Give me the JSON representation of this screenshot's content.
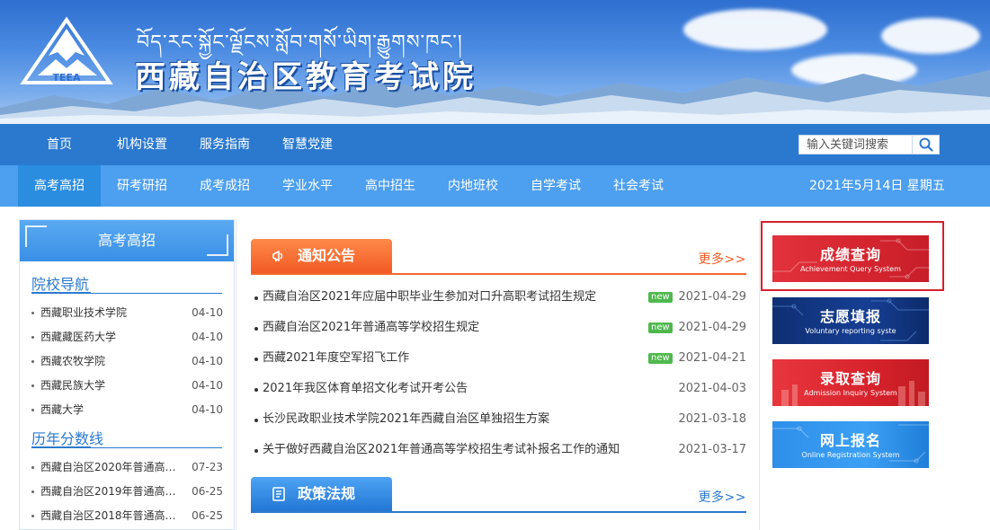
{
  "banner": {
    "tibetan_title": "བོད་རང་སྐྱོང་ལྗོངས་སློབ་གསོ་ཡིག་རྒྱུགས་ཁང་།",
    "site_title": "西藏自治区教育考试院",
    "logo_text": "TEEA"
  },
  "nav_main": [
    {
      "label": "首页"
    },
    {
      "label": "机构设置"
    },
    {
      "label": "服务指南"
    },
    {
      "label": "智慧党建"
    }
  ],
  "search": {
    "placeholder": "输入关键词搜索",
    "icon": "search-icon"
  },
  "nav_sub": [
    {
      "label": "高考高招"
    },
    {
      "label": "研考研招"
    },
    {
      "label": "成考成招"
    },
    {
      "label": "学业水平"
    },
    {
      "label": "高中招生"
    },
    {
      "label": "内地班校"
    },
    {
      "label": "自学考试"
    },
    {
      "label": "社会考试"
    }
  ],
  "date": "2021年5月14日 星期五",
  "sidebar": {
    "header": "高考高招",
    "sections": [
      {
        "title": "院校导航",
        "items": [
          {
            "label": "西藏职业技术学院",
            "date": "04-10"
          },
          {
            "label": "西藏藏医药大学",
            "date": "04-10"
          },
          {
            "label": "西藏农牧学院",
            "date": "04-10"
          },
          {
            "label": "西藏民族大学",
            "date": "04-10"
          },
          {
            "label": "西藏大学",
            "date": "04-10"
          }
        ]
      },
      {
        "title": "历年分数线",
        "items": [
          {
            "label": "西藏自治区2020年普通高等...",
            "date": "07-23"
          },
          {
            "label": "西藏自治区2019年普通高等...",
            "date": "06-25"
          },
          {
            "label": "西藏自治区2018年普通高等...",
            "date": "06-25"
          }
        ]
      }
    ]
  },
  "notice": {
    "title": "通知公告",
    "more": "更多>>",
    "items": [
      {
        "title": "西藏自治区2021年应届中职毕业生参加对口升高职考试招生规定",
        "badge": "new",
        "date": "2021-04-29"
      },
      {
        "title": "西藏自治区2021年普通高等学校招生规定",
        "badge": "new",
        "date": "2021-04-29"
      },
      {
        "title": "西藏2021年度空军招飞工作",
        "badge": "new",
        "date": "2021-04-21"
      },
      {
        "title": "2021年我区体育单招文化考试开考公告",
        "badge": "",
        "date": "2021-04-03"
      },
      {
        "title": "长沙民政职业技术学院2021年西藏自治区单独招生方案",
        "badge": "",
        "date": "2021-03-18"
      },
      {
        "title": "关于做好西藏自治区2021年普通高等学校招生考试补报名工作的通知",
        "badge": "",
        "date": "2021-03-17"
      }
    ]
  },
  "policy": {
    "title": "政策法规",
    "more": "更多>>"
  },
  "quick_links": [
    {
      "cn": "成绩查询",
      "en": "Achievement Query System",
      "color": "#d4252f"
    },
    {
      "cn": "志愿填报",
      "en": "Voluntary reporting syste",
      "color": "#163f94"
    },
    {
      "cn": "录取查询",
      "en": "Admission Inquiry System",
      "color": "#d8232c"
    },
    {
      "cn": "网上报名",
      "en": "Online Registration System",
      "color": "#3ba0f4"
    }
  ]
}
